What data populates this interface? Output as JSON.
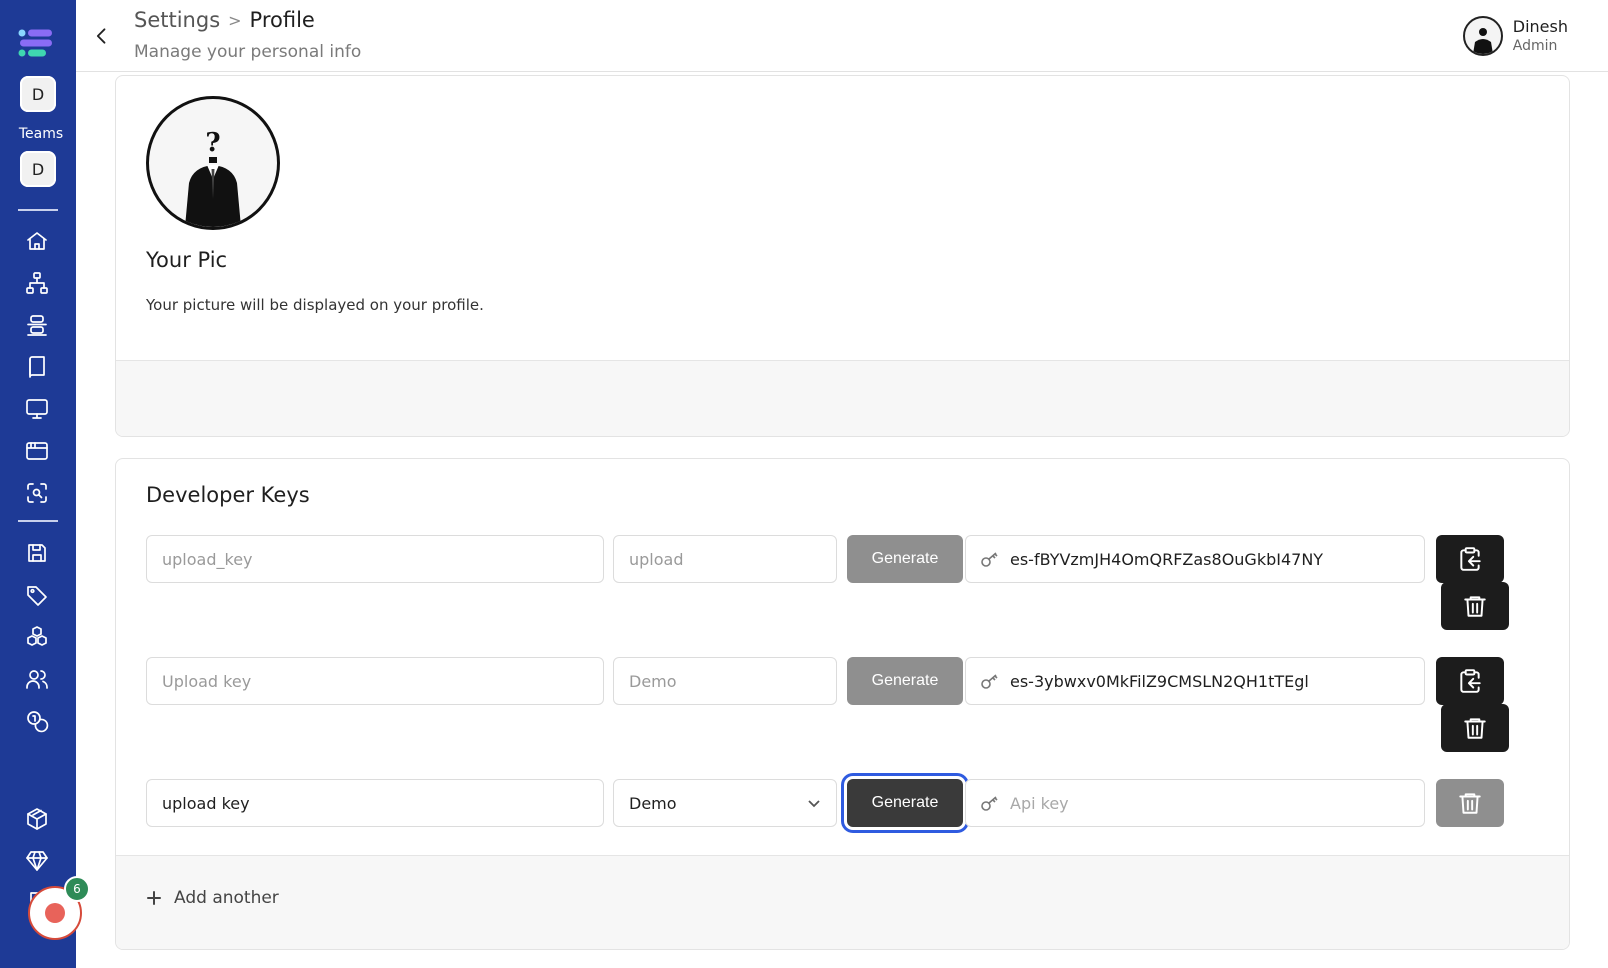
{
  "sidebar": {
    "teams_label": "Teams",
    "team_top_initial": "D",
    "team_bottom_initial": "D",
    "recorder_badge_count": "6",
    "nav_items": [
      "home-icon",
      "sitemap-icon",
      "stack-icon",
      "book-icon",
      "monitor-icon",
      "browser-window-icon",
      "scan-search-icon",
      "save-icon",
      "tag-icon",
      "cubes-icon",
      "users-icon",
      "coins-icon",
      "package-plus-icon",
      "gem-icon",
      "file-icon"
    ]
  },
  "header": {
    "breadcrumb_parent": "Settings",
    "breadcrumb_separator": ">",
    "breadcrumb_current": "Profile",
    "subtitle": "Manage your personal info",
    "user_name": "Dinesh",
    "user_role": "Admin"
  },
  "profile": {
    "pic_title": "Your Pic",
    "pic_description": "Your picture will be displayed on your profile."
  },
  "developer_keys": {
    "title": "Developer Keys",
    "generate_label": "Generate",
    "rows": [
      {
        "name_placeholder": "upload_key",
        "scope_placeholder": "upload",
        "api_key": "es-fBYVzmJH4OmQRFZas8OuGkbI47NY"
      },
      {
        "name_placeholder": "Upload key",
        "scope_placeholder": "Demo",
        "api_key": "es-3ybwxv0MkFilZ9CMSLN2QH1tTEgl"
      }
    ],
    "new_row": {
      "name_value": "upload key",
      "scope_value": "Demo",
      "api_key_placeholder": "Api key"
    },
    "add_another": "Add another"
  },
  "colors": {
    "sidebar_bg": "#1e3a96",
    "focus_ring": "#2f5be0",
    "generate_disabled": "#8f8f8f",
    "generate_active": "#3a3a3a",
    "badge": "#2e8b57",
    "recorder": "#e8635a"
  }
}
